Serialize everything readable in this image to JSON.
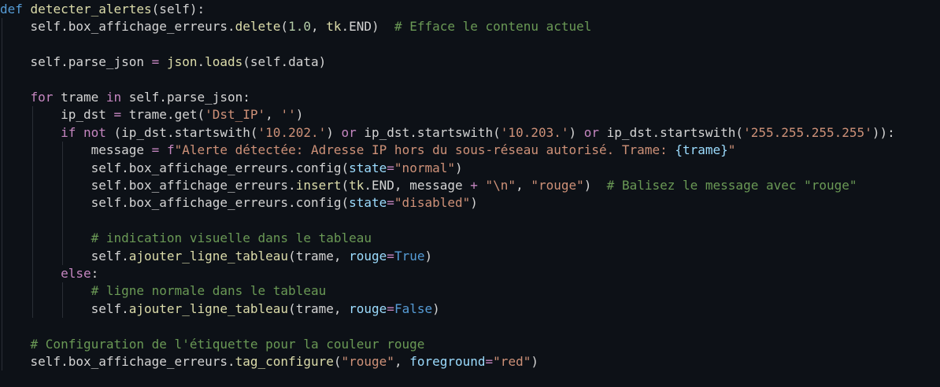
{
  "colors": {
    "background": "#0d1117",
    "keyword": "#c586c0",
    "def_keyword": "#569cd6",
    "function": "#dcdcaa",
    "string": "#ce9178",
    "number": "#b5cea8",
    "comment": "#6a9955",
    "variable": "#9cdcfe",
    "identifier": "#d4d4d4",
    "constant": "#569cd6",
    "indent_guide": "#2a2f36"
  },
  "lines": [
    [
      {
        "t": "def",
        "c": "def"
      },
      {
        "t": " ",
        "c": "id"
      },
      {
        "t": "detecter_alertes",
        "c": "fn"
      },
      {
        "t": "(self):",
        "c": "punc"
      }
    ],
    [
      {
        "t": "    ",
        "c": "id"
      },
      {
        "t": "self",
        "c": "id"
      },
      {
        "t": ".box_affichage_erreurs.",
        "c": "id"
      },
      {
        "t": "delete",
        "c": "fn"
      },
      {
        "t": "(",
        "c": "punc"
      },
      {
        "t": "1.0",
        "c": "num"
      },
      {
        "t": ", ",
        "c": "punc"
      },
      {
        "t": "tk",
        "c": "fn"
      },
      {
        "t": ".END)  ",
        "c": "id"
      },
      {
        "t": "# Efface le contenu actuel",
        "c": "cmt"
      }
    ],
    [],
    [
      {
        "t": "    ",
        "c": "id"
      },
      {
        "t": "self.parse_json ",
        "c": "id"
      },
      {
        "t": "=",
        "c": "kw"
      },
      {
        "t": " ",
        "c": "id"
      },
      {
        "t": "json",
        "c": "fn"
      },
      {
        "t": ".",
        "c": "id"
      },
      {
        "t": "loads",
        "c": "fn"
      },
      {
        "t": "(self.data)",
        "c": "id"
      }
    ],
    [],
    [
      {
        "t": "    ",
        "c": "id"
      },
      {
        "t": "for",
        "c": "kw"
      },
      {
        "t": " trame ",
        "c": "id"
      },
      {
        "t": "in",
        "c": "kw"
      },
      {
        "t": " self.parse_json:",
        "c": "id"
      }
    ],
    [
      {
        "t": "        ",
        "c": "id"
      },
      {
        "t": "ip_dst ",
        "c": "id"
      },
      {
        "t": "=",
        "c": "kw"
      },
      {
        "t": " trame.get(",
        "c": "id"
      },
      {
        "t": "'Dst_IP'",
        "c": "str"
      },
      {
        "t": ", ",
        "c": "punc"
      },
      {
        "t": "''",
        "c": "str"
      },
      {
        "t": ")",
        "c": "punc"
      }
    ],
    [
      {
        "t": "        ",
        "c": "id"
      },
      {
        "t": "if",
        "c": "kw"
      },
      {
        "t": " ",
        "c": "id"
      },
      {
        "t": "not",
        "c": "kw"
      },
      {
        "t": " (ip_dst.startswith(",
        "c": "id"
      },
      {
        "t": "'10.202.'",
        "c": "str"
      },
      {
        "t": ") ",
        "c": "id"
      },
      {
        "t": "or",
        "c": "kw"
      },
      {
        "t": " ip_dst.startswith(",
        "c": "id"
      },
      {
        "t": "'10.203.'",
        "c": "str"
      },
      {
        "t": ") ",
        "c": "id"
      },
      {
        "t": "or",
        "c": "kw"
      },
      {
        "t": " ip_dst.startswith(",
        "c": "id"
      },
      {
        "t": "'255.255.255.255'",
        "c": "str"
      },
      {
        "t": ")):",
        "c": "id"
      }
    ],
    [
      {
        "t": "            ",
        "c": "id"
      },
      {
        "t": "message ",
        "c": "id"
      },
      {
        "t": "=",
        "c": "kw"
      },
      {
        "t": " ",
        "c": "id"
      },
      {
        "t": "f",
        "c": "kw"
      },
      {
        "t": "\"Alerte détectée: Adresse IP hors du sous-réseau autorisé. Trame: ",
        "c": "str"
      },
      {
        "t": "{trame}",
        "c": "var"
      },
      {
        "t": "\"",
        "c": "str"
      }
    ],
    [
      {
        "t": "            ",
        "c": "id"
      },
      {
        "t": "self.box_affichage_erreurs.config(",
        "c": "id"
      },
      {
        "t": "state",
        "c": "kwarg"
      },
      {
        "t": "=",
        "c": "kw"
      },
      {
        "t": "\"normal\"",
        "c": "str"
      },
      {
        "t": ")",
        "c": "punc"
      }
    ],
    [
      {
        "t": "            ",
        "c": "id"
      },
      {
        "t": "self.box_affichage_erreurs.",
        "c": "id"
      },
      {
        "t": "insert",
        "c": "fn"
      },
      {
        "t": "(",
        "c": "punc"
      },
      {
        "t": "tk",
        "c": "fn"
      },
      {
        "t": ".END, message ",
        "c": "id"
      },
      {
        "t": "+",
        "c": "kw"
      },
      {
        "t": " ",
        "c": "id"
      },
      {
        "t": "\"\\n\"",
        "c": "str"
      },
      {
        "t": ", ",
        "c": "punc"
      },
      {
        "t": "\"rouge\"",
        "c": "str"
      },
      {
        "t": ")  ",
        "c": "punc"
      },
      {
        "t": "# Balisez le message avec \"rouge\"",
        "c": "cmt"
      }
    ],
    [
      {
        "t": "            ",
        "c": "id"
      },
      {
        "t": "self.box_affichage_erreurs.config(",
        "c": "id"
      },
      {
        "t": "state",
        "c": "kwarg"
      },
      {
        "t": "=",
        "c": "kw"
      },
      {
        "t": "\"disabled\"",
        "c": "str"
      },
      {
        "t": ")",
        "c": "punc"
      }
    ],
    [],
    [
      {
        "t": "            ",
        "c": "id"
      },
      {
        "t": "# indication visuelle dans le tableau",
        "c": "cmt"
      }
    ],
    [
      {
        "t": "            ",
        "c": "id"
      },
      {
        "t": "self.",
        "c": "id"
      },
      {
        "t": "ajouter_ligne_tableau",
        "c": "fn"
      },
      {
        "t": "(trame, ",
        "c": "id"
      },
      {
        "t": "rouge",
        "c": "kwarg"
      },
      {
        "t": "=",
        "c": "kw"
      },
      {
        "t": "True",
        "c": "const"
      },
      {
        "t": ")",
        "c": "punc"
      }
    ],
    [
      {
        "t": "        ",
        "c": "id"
      },
      {
        "t": "else",
        "c": "kw"
      },
      {
        "t": ":",
        "c": "punc"
      }
    ],
    [
      {
        "t": "            ",
        "c": "id"
      },
      {
        "t": "# ligne normale dans le tableau",
        "c": "cmt"
      }
    ],
    [
      {
        "t": "            ",
        "c": "id"
      },
      {
        "t": "self.",
        "c": "id"
      },
      {
        "t": "ajouter_ligne_tableau",
        "c": "fn"
      },
      {
        "t": "(trame, ",
        "c": "id"
      },
      {
        "t": "rouge",
        "c": "kwarg"
      },
      {
        "t": "=",
        "c": "kw"
      },
      {
        "t": "False",
        "c": "const"
      },
      {
        "t": ")",
        "c": "punc"
      }
    ],
    [],
    [
      {
        "t": "    ",
        "c": "id"
      },
      {
        "t": "# Configuration de l'étiquette pour la couleur rouge",
        "c": "cmt"
      }
    ],
    [
      {
        "t": "    ",
        "c": "id"
      },
      {
        "t": "self.box_affichage_erreurs.",
        "c": "id"
      },
      {
        "t": "tag_configure",
        "c": "fn"
      },
      {
        "t": "(",
        "c": "punc"
      },
      {
        "t": "\"rouge\"",
        "c": "str"
      },
      {
        "t": ", ",
        "c": "punc"
      },
      {
        "t": "foreground",
        "c": "kwarg"
      },
      {
        "t": "=",
        "c": "kw"
      },
      {
        "t": "\"red\"",
        "c": "str"
      },
      {
        "t": ")",
        "c": "punc"
      }
    ]
  ]
}
